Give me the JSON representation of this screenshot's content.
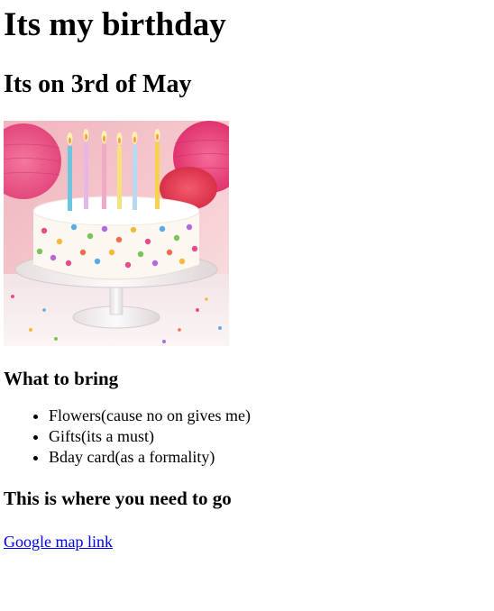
{
  "page": {
    "title": "Its my birthday",
    "subtitle": "Its on 3rd of May"
  },
  "image": {
    "alt": "Birthday cake with candles",
    "colors": {
      "background_pink": "#e9a7b4",
      "frosting": "#fbf7f1",
      "candle_colors": [
        "#6dc6df",
        "#e6b7e6",
        "#f2a9c8",
        "#f5e27a",
        "#b8d9f0",
        "#f7d24d"
      ],
      "sprinkle_colors": [
        "#e94b8a",
        "#f6b93b",
        "#7cc35a",
        "#5fa8e8",
        "#b36ad8",
        "#f26b4f"
      ]
    }
  },
  "bring": {
    "heading": "What to bring",
    "items": [
      "Flowers(cause no on gives me)",
      "Gifts(its a must)",
      "Bday card(as a formality)"
    ]
  },
  "directions": {
    "heading": "This is where you need to go",
    "link_text": "Google map link",
    "link_color": "#0000ee"
  }
}
